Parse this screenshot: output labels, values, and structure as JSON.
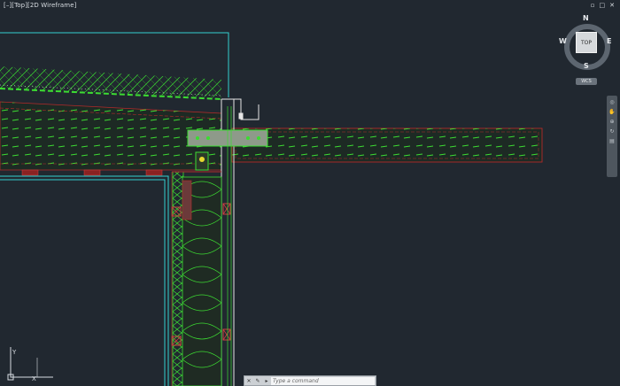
{
  "viewport": {
    "label": "[–][Top][2D Wireframe]"
  },
  "window_controls": {
    "restore": "▫",
    "minimize": "□",
    "close": "✕"
  },
  "viewcube": {
    "top_face": "TOP",
    "north": "N",
    "south": "S",
    "east": "E",
    "west": "W",
    "wcs_label": "WCS"
  },
  "ucs": {
    "x_label": "X",
    "y_label": "Y"
  },
  "command_line": {
    "close_icon": "✕",
    "customize_icon": "✎",
    "recent_icon": "▸",
    "placeholder": "Type a command"
  },
  "colors": {
    "background": "#212830",
    "green": "#3cdc32",
    "red": "#b42a2a",
    "cyan": "#34d0d0",
    "white": "#e6e6e6",
    "yellow": "#e6d830"
  }
}
